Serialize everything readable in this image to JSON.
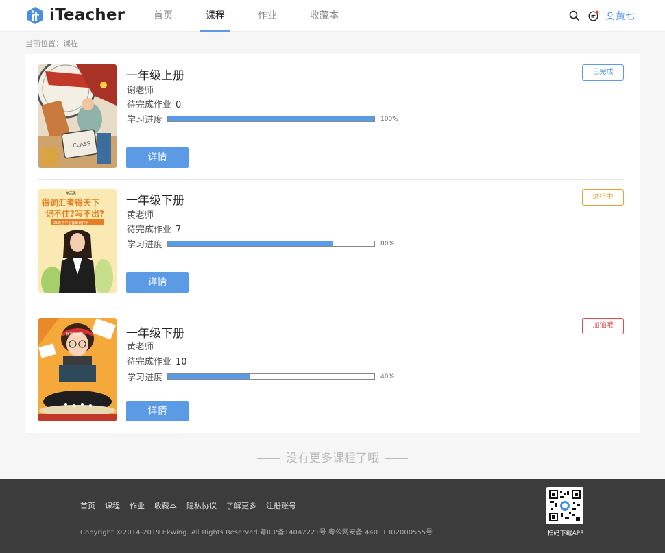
{
  "header": {
    "logo_text": "iTeacher",
    "nav": [
      {
        "label": "首页",
        "active": false
      },
      {
        "label": "课程",
        "active": true
      },
      {
        "label": "作业",
        "active": false
      },
      {
        "label": "收藏本",
        "active": false
      }
    ],
    "user_name": "黄七"
  },
  "breadcrumb": "当前位置：课程",
  "courses": [
    {
      "title": "一年级上册",
      "teacher": "谢老师",
      "pending_label": "待完成作业",
      "pending_count": "0",
      "progress_label": "学习进度",
      "progress": 1.0,
      "progress_text": "100%",
      "status": "已完成",
      "status_color": "#5b9be6",
      "button": "详情"
    },
    {
      "title": "一年级下册",
      "teacher": "黄老师",
      "pending_label": "待完成作业",
      "pending_count": "7",
      "progress_label": "学习进度",
      "progress": 0.8,
      "progress_text": "80%",
      "status": "进行中",
      "status_color": "#e8a33b",
      "button": "详情"
    },
    {
      "title": "一年级下册",
      "teacher": "黄老师",
      "pending_label": "待完成作业",
      "pending_count": "10",
      "progress_label": "学习进度",
      "progress": 0.4,
      "progress_text": "40%",
      "status": "加油哦",
      "status_color": "#e24b4b",
      "button": "详情"
    }
  ],
  "covers": [
    {
      "text": "CLASS"
    },
    {
      "text_1": "学而思",
      "text_2": "得词汇者得天下",
      "text_3": "记不住?写不出?",
      "text_4": "21天初中必备单词打卡"
    },
    {
      "text": "我不会放弃"
    }
  ],
  "no_more": "没有更多课程了哦",
  "footer": {
    "links": [
      "首页",
      "课程",
      "作业",
      "收藏本",
      "隐私协议",
      "了解更多",
      "注册账号"
    ],
    "copyright": "Copyright ©2014-2019 Ekwing. All Rights Reserved.粤ICP备14042221号  粤公网安备 44011302000555号",
    "qr_label": "扫码下载APP"
  },
  "colors": {
    "accent": "#5b9be6",
    "footer_bg": "#3c3c3c"
  }
}
